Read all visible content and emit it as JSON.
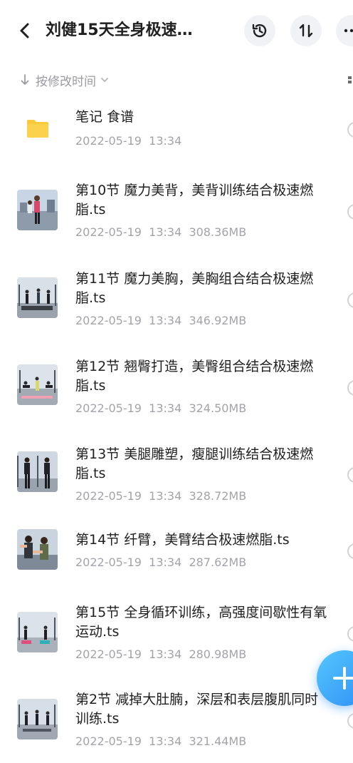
{
  "header": {
    "title": "刘健15天全身极速…"
  },
  "sort": {
    "label": "按修改时间"
  },
  "colors": {
    "folder": "#f8ca3c",
    "accent": "#3197f5",
    "secondary_text": "#a3a3aa"
  },
  "items": [
    {
      "name": "笔记 食谱",
      "meta": "2022-05-19  13:34",
      "type": "folder"
    },
    {
      "name": "第10节 魔力美背，美背训练结合极速燃脂.ts",
      "meta": "2022-05-19  13:34  308.36MB",
      "type": "video"
    },
    {
      "name": "第11节 魔力美胸，美胸组合结合极速燃脂.ts",
      "meta": "2022-05-19  13:34  346.92MB",
      "type": "video"
    },
    {
      "name": "第12节 翘臀打造，美臀组合结合极速燃脂.ts",
      "meta": "2022-05-19  13:34  324.50MB",
      "type": "video"
    },
    {
      "name": "第13节 美腿雕塑，瘦腿训练结合极速燃脂.ts",
      "meta": "2022-05-19  13:34  328.72MB",
      "type": "video"
    },
    {
      "name": "第14节 纤臂，美臂结合极速燃脂.ts",
      "meta": "2022-05-19  13:34  287.62MB",
      "type": "video"
    },
    {
      "name": "第15节 全身循环训练，高强度间歇性有氧运动.ts",
      "meta": "2022-05-19  13:34  280.98MB",
      "type": "video"
    },
    {
      "name": "第2节 减掉大肚腩，深层和表层腹肌同时训练.ts",
      "meta": "2022-05-19  13:34  321.44MB",
      "type": "video"
    }
  ]
}
